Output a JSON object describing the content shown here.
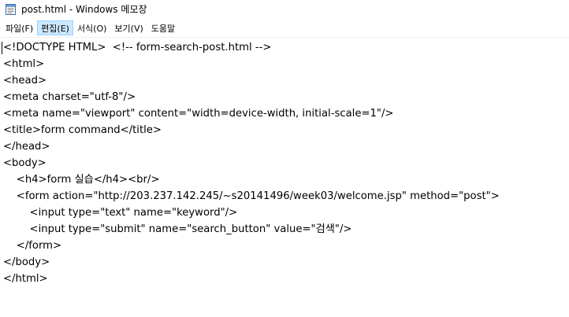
{
  "window": {
    "title": "post.html - Windows 메모장"
  },
  "icons": {
    "app": "notepad-icon"
  },
  "menu": {
    "items": [
      {
        "label": "파일(F)"
      },
      {
        "label": "편집(E)"
      },
      {
        "label": "서식(O)"
      },
      {
        "label": "보기(V)"
      },
      {
        "label": "도움말"
      }
    ],
    "active_index": 1
  },
  "editor": {
    "lines": [
      "<!DOCTYPE HTML>  <!-- form-search-post.html -->",
      "<html>",
      "<head>",
      "<meta charset=\"utf-8\"/>",
      "<meta name=\"viewport\" content=\"width=device-width, initial-scale=1\"/>",
      "<title>form command</title>",
      "</head>",
      "<body>",
      "    <h4>form 실습</h4><br/>",
      "    <form action=\"http://203.237.142.245/~s20141496/week03/welcome.jsp\" method=\"post\">",
      "        <input type=\"text\" name=\"keyword\"/>",
      "        <input type=\"submit\" name=\"search_button\" value=\"검색\"/>",
      "    </form>",
      "</body>",
      "</html>"
    ]
  },
  "colors": {
    "menu_active_bg": "#cce8ff",
    "menu_active_border": "#99d1ff",
    "text": "#000000",
    "background": "#ffffff"
  }
}
